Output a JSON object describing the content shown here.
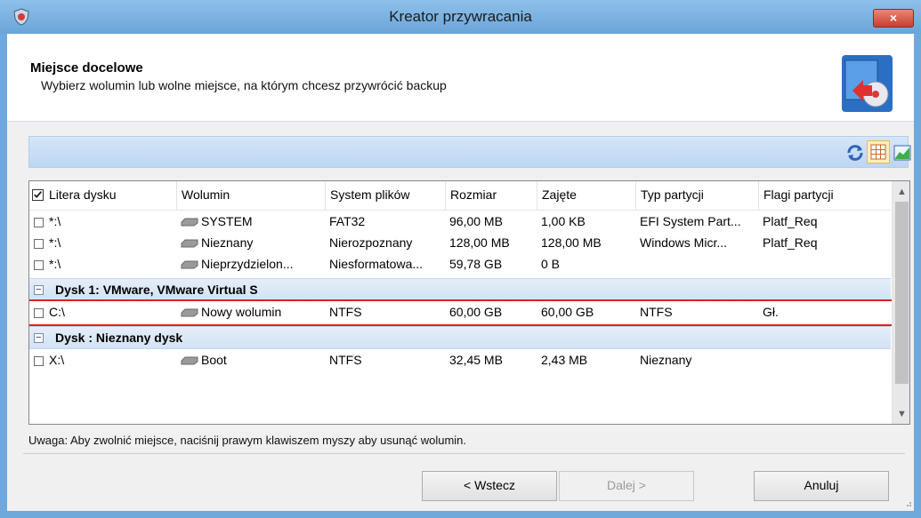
{
  "window": {
    "title": "Kreator przywracania",
    "close_label": "×"
  },
  "header": {
    "title": "Miejsce docelowe",
    "subtitle": "Wybierz wolumin lub wolne miejsce, na którym chcesz przywrócić backup"
  },
  "table": {
    "columns": [
      "Litera dysku",
      "Wolumin",
      "System plików",
      "Rozmiar",
      "Zajęte",
      "Typ partycji",
      "Flagi partycji"
    ],
    "rows_top": [
      {
        "letter": "*:\\",
        "volume": "SYSTEM",
        "fs": "FAT32",
        "size": "96,00 MB",
        "used": "1,00 KB",
        "type": "EFI System Part...",
        "flags": "Platf_Req"
      },
      {
        "letter": "*:\\",
        "volume": "Nieznany",
        "fs": "Nierozpoznany",
        "size": "128,00 MB",
        "used": "128,00 MB",
        "type": "Windows Micr...",
        "flags": "Platf_Req"
      },
      {
        "letter": "*:\\",
        "volume": "Nieprzydzielon...",
        "fs": "Niesformatowa...",
        "size": "59,78 GB",
        "used": "0 B",
        "type": "",
        "flags": ""
      }
    ],
    "group1": {
      "label": "Dysk 1: VMware, VMware Virtual S",
      "toggle": "−",
      "rows": [
        {
          "letter": "C:\\",
          "volume": "Nowy wolumin",
          "fs": "NTFS",
          "size": "60,00 GB",
          "used": "60,00 GB",
          "type": "NTFS",
          "flags": "Gł."
        }
      ]
    },
    "group2": {
      "label": "Dysk : Nieznany dysk",
      "toggle": "−",
      "rows": [
        {
          "letter": "X:\\",
          "volume": "Boot",
          "fs": "NTFS",
          "size": "32,45 MB",
          "used": "2,43 MB",
          "type": "Nieznany",
          "flags": ""
        }
      ]
    }
  },
  "note": "Uwaga: Aby zwolnić miejsce, naciśnij prawym klawiszem myszy aby usunąć wolumin.",
  "buttons": {
    "back": "< Wstecz",
    "next": "Dalej >",
    "cancel": "Anuluj"
  },
  "colors": {
    "titlebar": "#6fa9dc",
    "highlight_border": "#e02020",
    "group_band": "#d2e2f4"
  }
}
